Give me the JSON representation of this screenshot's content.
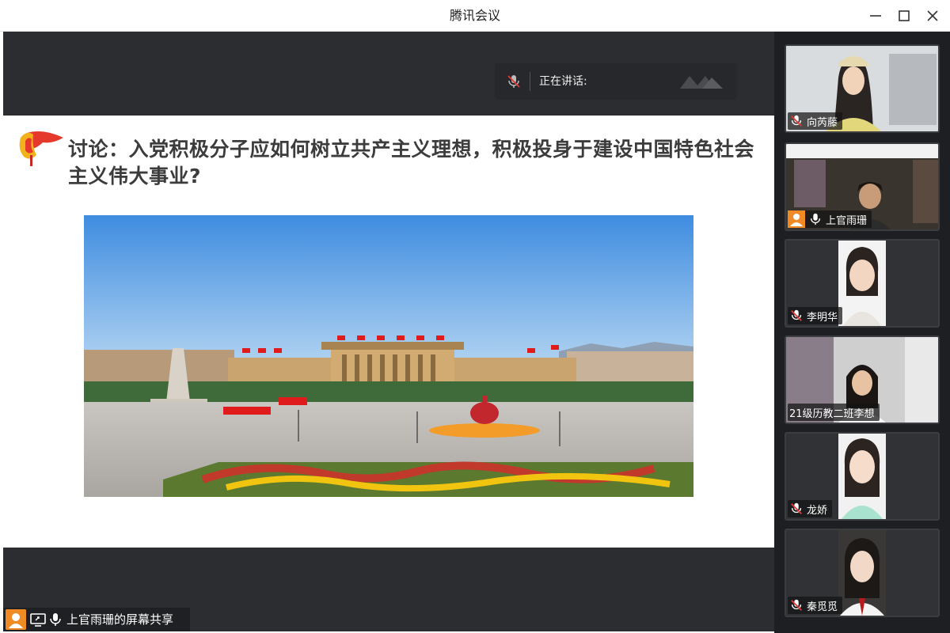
{
  "window": {
    "title": "腾讯会议"
  },
  "speaking": {
    "label": "正在讲话:"
  },
  "slide": {
    "heading": "讨论：入党积极分子应如何树立共产主义理想，积极投身于建设中国特色社会主义伟大事业?"
  },
  "share_bar": {
    "label": "上官雨珊的屏幕共享"
  },
  "participants": [
    {
      "name": "向芮藤",
      "mic": "muted"
    },
    {
      "name": "上官雨珊",
      "mic": "on",
      "host": true
    },
    {
      "name": "李明华",
      "mic": "muted"
    },
    {
      "name": "21级历教二班李想",
      "mic": "none"
    },
    {
      "name": "龙娇",
      "mic": "muted"
    },
    {
      "name": "秦觅觅",
      "mic": "muted"
    }
  ],
  "colors": {
    "accent": "#f08a24",
    "share_bg": "#2b2d30",
    "panel_bg": "#1e1f22"
  }
}
